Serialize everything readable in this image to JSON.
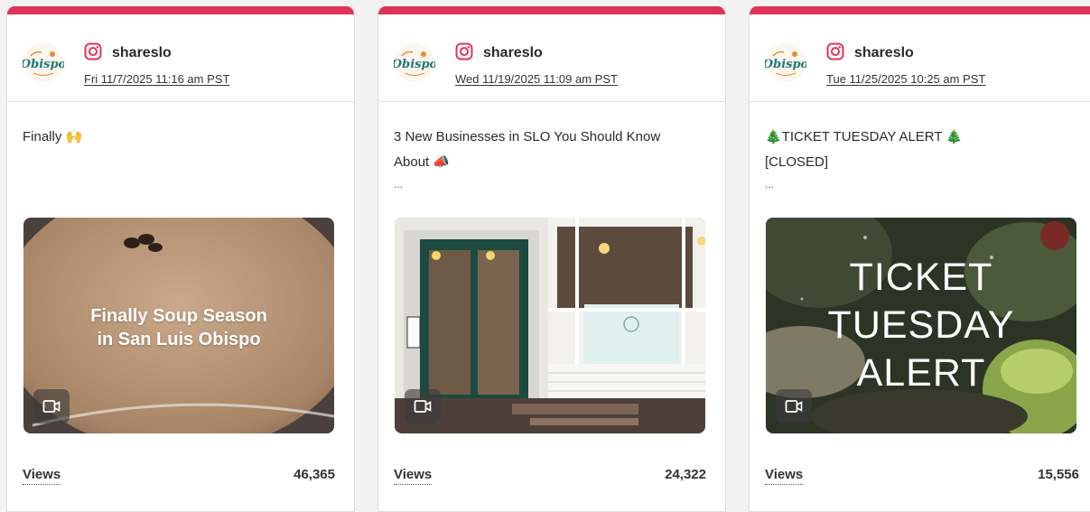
{
  "accent_color": "#e0335a",
  "cards": [
    {
      "account": "shareslo",
      "date": "Fri 11/7/2025 11:16 am PST",
      "caption_lines": [
        "Finally 🙌"
      ],
      "more": "",
      "media_text": [
        "Finally Soup Season",
        "in San Luis Obispo"
      ],
      "metric_label": "Views",
      "metric_value": "46,365"
    },
    {
      "account": "shareslo",
      "date": "Wed 11/19/2025 11:09 am PST",
      "caption_lines": [
        "3 New Businesses in SLO You Should Know",
        "About 📣"
      ],
      "more": "...",
      "media_text": [],
      "metric_label": "Views",
      "metric_value": "24,322"
    },
    {
      "account": "shareslo",
      "date": "Tue 11/25/2025 10:25 am PST",
      "caption_lines": [
        "🎄TICKET TUESDAY ALERT 🎄",
        "[CLOSED]"
      ],
      "more": "...",
      "media_text": [
        "TICKET",
        "TUESDAY",
        "ALERT"
      ],
      "metric_label": "Views",
      "metric_value": "15,556"
    }
  ],
  "icons": {
    "logo": "san-luis-obispo-logo",
    "platform": "instagram-icon",
    "media_type": "video-icon"
  }
}
